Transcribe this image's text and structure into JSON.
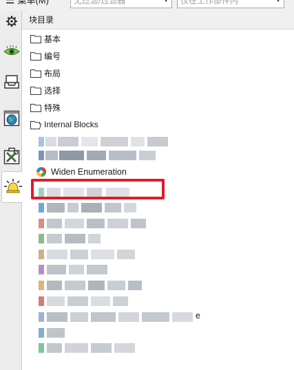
{
  "toolbar": {
    "menu_label": "菜单(M)",
    "filter_placeholder": "无过滤/过滤器",
    "search_placeholder": "仅在工作部件内"
  },
  "left_tools": [
    {
      "name": "settings-gear-icon"
    },
    {
      "name": "view-eye-icon"
    },
    {
      "name": "tray-icon"
    },
    {
      "name": "globe-screen-icon"
    },
    {
      "name": "tools-icon"
    },
    {
      "name": "alarm-bell-icon"
    }
  ],
  "panel": {
    "title": "块目录",
    "folders": [
      {
        "label": "基本"
      },
      {
        "label": "编号"
      },
      {
        "label": "布局"
      },
      {
        "label": "选择"
      },
      {
        "label": "特殊"
      },
      {
        "label": "Internal Blocks"
      }
    ],
    "highlighted_block": {
      "label": "Widen Enumeration",
      "icon": "widen-block-icon"
    },
    "obscured_block_count": 14,
    "trailing_visible_char": "e"
  },
  "colors": {
    "highlight_border": "#e01b2a",
    "panel_bg": "#ffffff",
    "chrome_bg": "#f0f0f0"
  }
}
